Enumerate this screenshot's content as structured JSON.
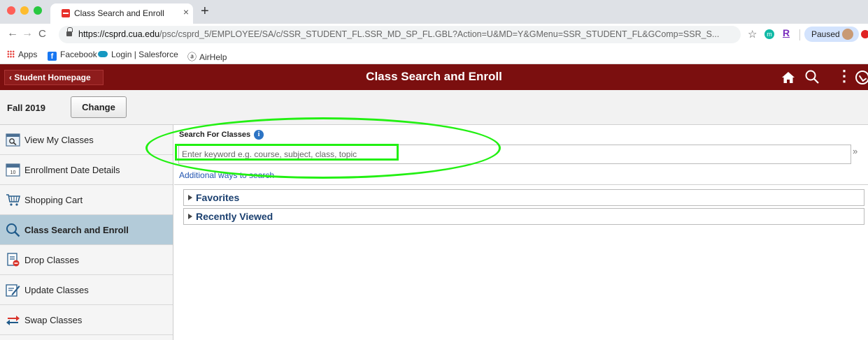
{
  "browser": {
    "tab_title": "Class Search and Enroll",
    "tab_close": "×",
    "new_tab": "+",
    "back": "←",
    "forward": "→",
    "reload": "C",
    "url_host": "https://csprd.cua.edu",
    "url_path": "/psc/csprd_5/EMPLOYEE/SA/c/SSR_STUDENT_FL.SSR_MD_SP_FL.GBL?Action=U&MD=Y&GMenu=SSR_STUDENT_FL&GComp=SSR_S...",
    "star": "☆",
    "ext_m": "m",
    "ext_r": "R",
    "profile_status": "Paused"
  },
  "bookmarks": [
    {
      "label": "Apps",
      "icon": "apps-grid-icon"
    },
    {
      "label": "Facebook",
      "icon": "facebook-icon"
    },
    {
      "label": "Login | Salesforce",
      "icon": "salesforce-cloud-icon"
    },
    {
      "label": "AirHelp",
      "icon": "airhelp-icon"
    }
  ],
  "header": {
    "back_link": "‹ Student Homepage",
    "title": "Class Search and Enroll",
    "more": "⋮"
  },
  "term": {
    "label": "Fall 2019",
    "change_label": "Change"
  },
  "sidebar": {
    "items": [
      {
        "label": "View My Classes",
        "icon": "view-classes-icon"
      },
      {
        "label": "Enrollment Date Details",
        "icon": "calendar-icon"
      },
      {
        "label": "Shopping Cart",
        "icon": "shopping-cart-icon"
      },
      {
        "label": "Class Search and Enroll",
        "icon": "search-icon",
        "active": true
      },
      {
        "label": "Drop Classes",
        "icon": "drop-classes-icon"
      },
      {
        "label": "Update Classes",
        "icon": "update-classes-icon"
      },
      {
        "label": "Swap Classes",
        "icon": "swap-arrows-icon"
      }
    ]
  },
  "main": {
    "search_label": "Search For Classes",
    "info": "i",
    "search_placeholder": "Enter keyword e.g. course, subject, class, topic",
    "go_symbol": "»",
    "additional_link": "Additional ways to search",
    "groups": [
      {
        "label": "Favorites"
      },
      {
        "label": "Recently Viewed"
      }
    ]
  },
  "colors": {
    "header_bg": "#7b0f0f",
    "active_item_bg": "#b3cbd9",
    "annotation_green": "#22f012",
    "link": "#2255b0"
  }
}
